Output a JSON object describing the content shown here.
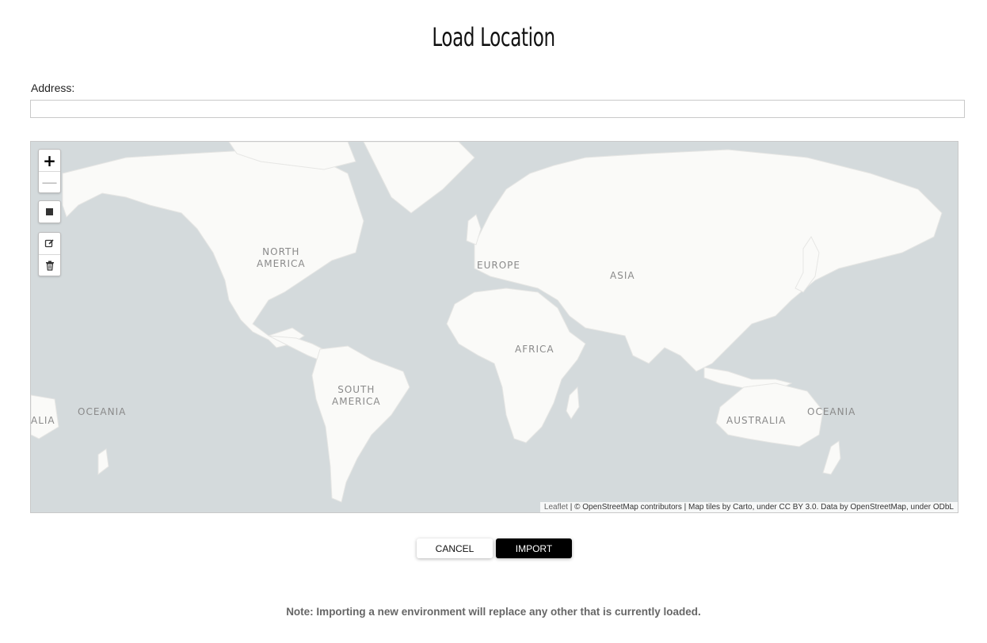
{
  "dialog": {
    "title": "Load Location",
    "address_label": "Address:",
    "address_value": "",
    "address_placeholder": ""
  },
  "map": {
    "labels": {
      "north_america": "NORTH\nAMERICA",
      "south_america": "SOUTH\nAMERICA",
      "europe": "EUROPE",
      "asia": "ASIA",
      "africa": "AFRICA",
      "australia": "AUSTRALIA",
      "oceania_left": "OCEANIA",
      "oceania_right": "OCEANIA",
      "australia_wrap": "ALIA"
    },
    "controls": {
      "zoom_in": "+",
      "zoom_out": "—"
    },
    "attribution": {
      "leaflet": "Leaflet",
      "rest": " | © OpenStreetMap contributors | Map tiles by Carto, under CC BY 3.0. Data by OpenStreetMap, under ODbL"
    },
    "colors": {
      "water": "#d4dadc",
      "land": "#fafaf8"
    }
  },
  "actions": {
    "cancel_label": "CANCEL",
    "import_label": "IMPORT"
  },
  "note": "Note: Importing a new environment will replace any other that is currently loaded."
}
